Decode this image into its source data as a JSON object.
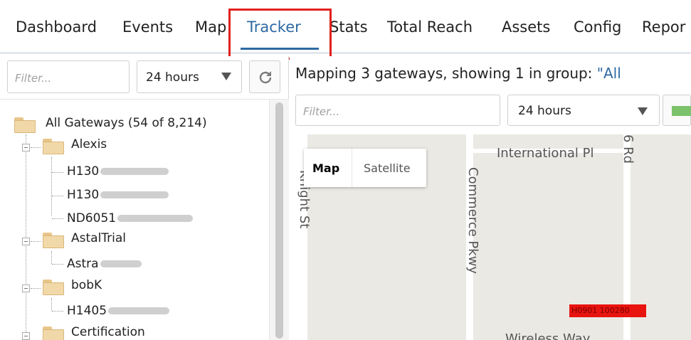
{
  "nav": {
    "items": [
      {
        "label": "Dashboard"
      },
      {
        "label": "Events"
      },
      {
        "label": "Map"
      },
      {
        "label": "Tracker"
      },
      {
        "label": "Stats"
      },
      {
        "label": "Total Reach"
      },
      {
        "label": "Assets"
      },
      {
        "label": "Config"
      },
      {
        "label": "Repor"
      }
    ],
    "active_label": "Tracker",
    "highlight_color": "#e1211f",
    "accent_color": "#2d6aa3"
  },
  "left": {
    "filter_placeholder": "Filter...",
    "time_range": "24 hours",
    "refresh_icon": "refresh-icon"
  },
  "tree": {
    "root_label": "All Gateways (54 of 8,214)",
    "groups": [
      {
        "label": "Alexis",
        "children": [
          "H130",
          "H130",
          "ND6051"
        ]
      },
      {
        "label": "AstalTrial",
        "children": [
          "Astra"
        ]
      },
      {
        "label": "bobK",
        "children": [
          "H1405"
        ]
      },
      {
        "label": "Certification",
        "children": []
      }
    ]
  },
  "right": {
    "mapping_text": "Mapping 3 gateways, showing 1 in group: ",
    "mapping_link": "\"All",
    "filter_placeholder": "Filter...",
    "time_range": "24 hours"
  },
  "map": {
    "type_buttons": [
      "Map",
      "Satellite"
    ],
    "active_type": "Map",
    "road_labels": {
      "international": "International Pl",
      "commerce": "Commerce Pkwy",
      "knight": "Knight St",
      "rd": "6 Rd",
      "wireless": "Wireless Way"
    },
    "marker_label": "H0901 100280",
    "marker_color": "#e8140f"
  }
}
